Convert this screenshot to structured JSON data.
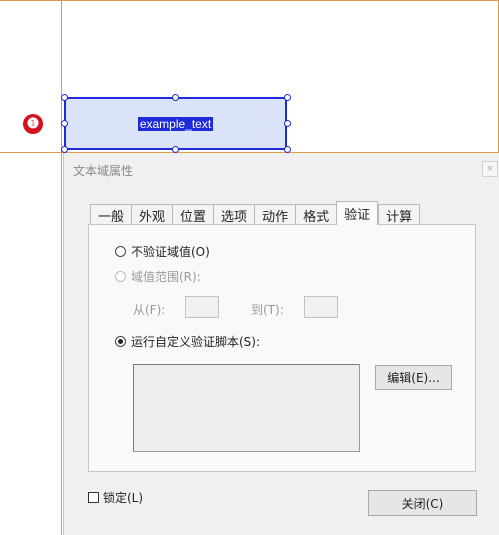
{
  "annotation": {
    "number": "❶"
  },
  "field": {
    "text": "example_text"
  },
  "dialog": {
    "title": "文本域属性",
    "close_glyph": "×",
    "tabs": [
      {
        "label": "一般"
      },
      {
        "label": "外观"
      },
      {
        "label": "位置"
      },
      {
        "label": "选项"
      },
      {
        "label": "动作"
      },
      {
        "label": "格式"
      },
      {
        "label": "验证",
        "active": true
      },
      {
        "label": "计算"
      }
    ],
    "validation": {
      "no_validate_label": "不验证域值(O)",
      "range_label": "域值范围(R):",
      "from_label": "从(F):",
      "to_label": "到(T):",
      "custom_script_label": "运行自定义验证脚本(S):",
      "edit_button_label": "编辑(E)...",
      "selected": "custom_script"
    },
    "lock_label": "锁定(L)",
    "close_button_label": "关闭(C)"
  }
}
